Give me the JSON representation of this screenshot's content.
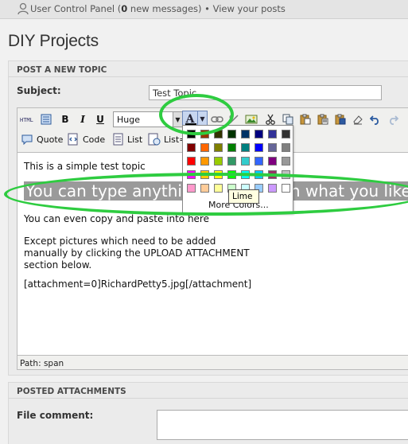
{
  "topbar": {
    "prefix": "User Control Panel (",
    "count": "0",
    "suffix": " new messages) • View your posts"
  },
  "page": {
    "title": "DIY Projects"
  },
  "post_panel": {
    "header": "POST A NEW TOPIC",
    "subject_label": "Subject:",
    "subject_value": "Test Topic"
  },
  "toolbar": {
    "html_label": "HTML",
    "bold": "B",
    "italic": "I",
    "underline": "U",
    "font_size": "Huge",
    "color_letter": "A",
    "quote": "Quote",
    "code": "Code",
    "list": "List",
    "list_eq": "List="
  },
  "editor": {
    "line1": "This is a simple test topic",
    "big_line": "You can type anything you want in what you like.",
    "line3": "You can even copy and paste into here",
    "line4a": "Except pictures which need to be added",
    "line4b": "manually by clicking the UPLOAD ATTACHMENT",
    "line4c": "section below.",
    "line5": "[attachment=0]RichardPetty5.jpg[/attachment]",
    "path": "Path: span"
  },
  "color_picker": {
    "more_colors": "More Colors...",
    "tooltip": "Lime",
    "rows": [
      [
        "#000000",
        "#993300",
        "#333300",
        "#003300",
        "#003366",
        "#000080",
        "#333399",
        "#333333"
      ],
      [
        "#800000",
        "#ff6600",
        "#808000",
        "#008000",
        "#008080",
        "#0000ff",
        "#666699",
        "#808080"
      ],
      [
        "#ff0000",
        "#ff9900",
        "#99cc00",
        "#339966",
        "#33cccc",
        "#3366ff",
        "#800080",
        "#999999"
      ],
      [
        "#ff00ff",
        "#ffcc00",
        "#ffff00",
        "#00ff00",
        "#00ffff",
        "#00ccff",
        "#993366",
        "#c0c0c0"
      ],
      [
        "#ff99cc",
        "#ffcc99",
        "#ffff99",
        "#ccffcc",
        "#ccffff",
        "#99ccff",
        "#cc99ff",
        "#ffffff"
      ]
    ]
  },
  "attach_panel": {
    "header": "POSTED ATTACHMENTS",
    "file_comment_label": "File comment:"
  },
  "colors": {
    "highlight": "#2ecc40",
    "selection": "#9a9a9a"
  }
}
